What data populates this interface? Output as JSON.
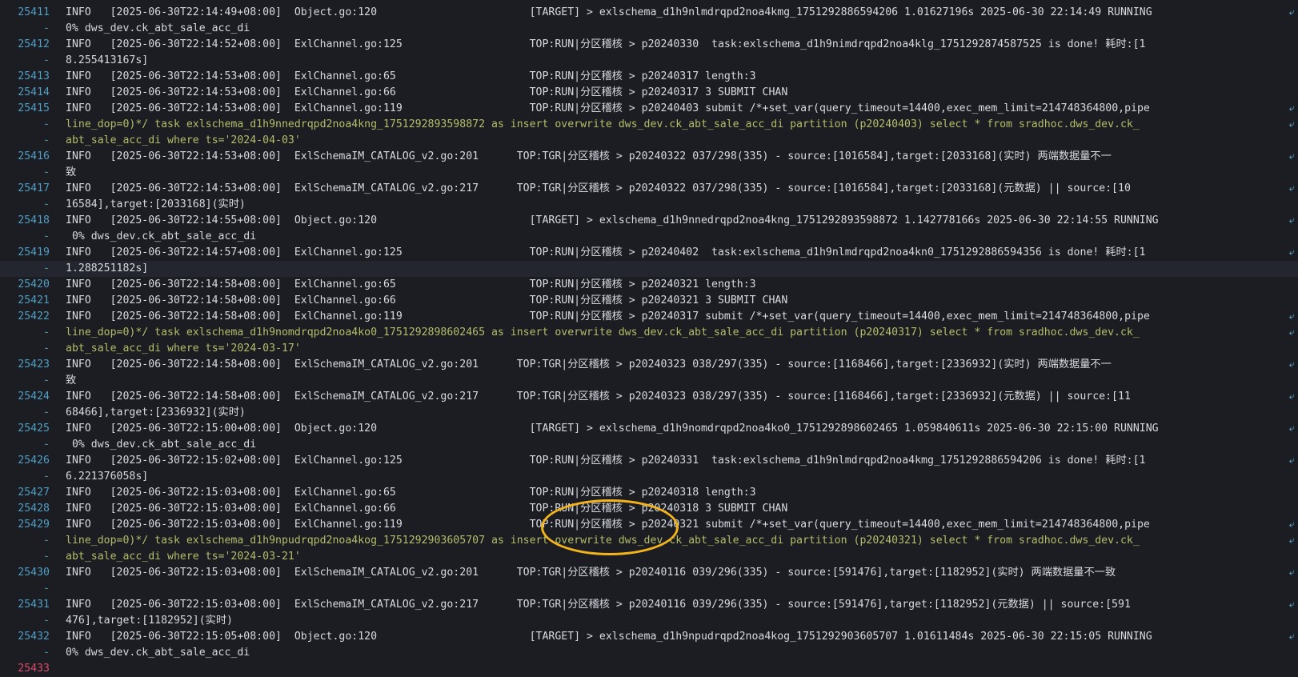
{
  "lines": [
    {
      "gutter": "25411",
      "text": "INFO   [2025-06-30T22:14:49+08:00]  Object.go:120                        [TARGET] > exlschema_d1h9nlmdrqpd2noa4kmg_1751292886594206 1.01627196s 2025-06-30 22:14:49 RUNNING",
      "wrap": true
    },
    {
      "gutter": "-",
      "text": "0% dws_dev.ck_abt_sale_acc_di"
    },
    {
      "gutter": "25412",
      "text": "INFO   [2025-06-30T22:14:52+08:00]  ExlChannel.go:125                    TOP:RUN|分区稽核 > p20240330  task:exlschema_d1h9nimdrqpd2noa4klg_1751292874587525 is done! 耗时:[1",
      "wrap": false
    },
    {
      "gutter": "-",
      "text": "8.255413167s]"
    },
    {
      "gutter": "25413",
      "text": "INFO   [2025-06-30T22:14:53+08:00]  ExlChannel.go:65                     TOP:RUN|分区稽核 > p20240317 length:3"
    },
    {
      "gutter": "25414",
      "text": "INFO   [2025-06-30T22:14:53+08:00]  ExlChannel.go:66                     TOP:RUN|分区稽核 > p20240317 3 SUBMIT CHAN"
    },
    {
      "gutter": "25415",
      "text": "INFO   [2025-06-30T22:14:53+08:00]  ExlChannel.go:119                    TOP:RUN|分区稽核 > p20240403 submit /*+set_var(query_timeout=14400,exec_mem_limit=214748364800,pipe",
      "wrap": true
    },
    {
      "gutter": "-",
      "text": "line_dop=0)*/ task exlschema_d1h9nnedrqpd2noa4kng_1751292893598872 as insert overwrite dws_dev.ck_abt_sale_acc_di partition (p20240403) select * from sradhoc.dws_dev.ck_",
      "wrap": true
    },
    {
      "gutter": "-",
      "text": "abt_sale_acc_di where ts='2024-04-03'"
    },
    {
      "gutter": "25416",
      "text": "INFO   [2025-06-30T22:14:53+08:00]  ExlSchemaIM_CATALOG_v2.go:201      TOP:TGR|分区稽核 > p20240322 037/298(335) - source:[1016584],target:[2033168](实时) 两端数据量不一",
      "wrap": true
    },
    {
      "gutter": "-",
      "text": "致"
    },
    {
      "gutter": "25417",
      "text": "INFO   [2025-06-30T22:14:53+08:00]  ExlSchemaIM_CATALOG_v2.go:217      TOP:TGR|分区稽核 > p20240322 037/298(335) - source:[1016584],target:[2033168](元数据) || source:[10",
      "wrap": true
    },
    {
      "gutter": "-",
      "text": "16584],target:[2033168](实时)"
    },
    {
      "gutter": "25418",
      "text": "INFO   [2025-06-30T22:14:55+08:00]  Object.go:120                        [TARGET] > exlschema_d1h9nnedrqpd2noa4kng_1751292893598872 1.142778166s 2025-06-30 22:14:55 RUNNING",
      "wrap": true
    },
    {
      "gutter": "-",
      "text": " 0% dws_dev.ck_abt_sale_acc_di"
    },
    {
      "gutter": "25419",
      "text": "INFO   [2025-06-30T22:14:57+08:00]  ExlChannel.go:125                    TOP:RUN|分区稽核 > p20240402  task:exlschema_d1h9nlmdrqpd2noa4kn0_1751292886594356 is done! 耗时:[1",
      "wrap": true
    },
    {
      "gutter": "-",
      "text": "1.288251182s]",
      "hl": true
    },
    {
      "gutter": "25420",
      "text": "INFO   [2025-06-30T22:14:58+08:00]  ExlChannel.go:65                     TOP:RUN|分区稽核 > p20240321 length:3"
    },
    {
      "gutter": "25421",
      "text": "INFO   [2025-06-30T22:14:58+08:00]  ExlChannel.go:66                     TOP:RUN|分区稽核 > p20240321 3 SUBMIT CHAN"
    },
    {
      "gutter": "25422",
      "text": "INFO   [2025-06-30T22:14:58+08:00]  ExlChannel.go:119                    TOP:RUN|分区稽核 > p20240317 submit /*+set_var(query_timeout=14400,exec_mem_limit=214748364800,pipe",
      "wrap": true
    },
    {
      "gutter": "-",
      "text": "line_dop=0)*/ task exlschema_d1h9nomdrqpd2noa4ko0_1751292898602465 as insert overwrite dws_dev.ck_abt_sale_acc_di partition (p20240317) select * from sradhoc.dws_dev.ck_",
      "wrap": true
    },
    {
      "gutter": "-",
      "text": "abt_sale_acc_di where ts='2024-03-17'"
    },
    {
      "gutter": "25423",
      "text": "INFO   [2025-06-30T22:14:58+08:00]  ExlSchemaIM_CATALOG_v2.go:201      TOP:TGR|分区稽核 > p20240323 038/297(335) - source:[1168466],target:[2336932](实时) 两端数据量不一",
      "wrap": true
    },
    {
      "gutter": "-",
      "text": "致"
    },
    {
      "gutter": "25424",
      "text": "INFO   [2025-06-30T22:14:58+08:00]  ExlSchemaIM_CATALOG_v2.go:217      TOP:TGR|分区稽核 > p20240323 038/297(335) - source:[1168466],target:[2336932](元数据) || source:[11",
      "wrap": true
    },
    {
      "gutter": "-",
      "text": "68466],target:[2336932](实时)"
    },
    {
      "gutter": "25425",
      "text": "INFO   [2025-06-30T22:15:00+08:00]  Object.go:120                        [TARGET] > exlschema_d1h9nomdrqpd2noa4ko0_1751292898602465 1.059840611s 2025-06-30 22:15:00 RUNNING",
      "wrap": true
    },
    {
      "gutter": "-",
      "text": " 0% dws_dev.ck_abt_sale_acc_di"
    },
    {
      "gutter": "25426",
      "text": "INFO   [2025-06-30T22:15:02+08:00]  ExlChannel.go:125                    TOP:RUN|分区稽核 > p20240331  task:exlschema_d1h9nlmdrqpd2noa4kmg_1751292886594206 is done! 耗时:[1",
      "wrap": true
    },
    {
      "gutter": "-",
      "text": "6.221376058s]"
    },
    {
      "gutter": "25427",
      "text": "INFO   [2025-06-30T22:15:03+08:00]  ExlChannel.go:65                     TOP:RUN|分区稽核 > p20240318 length:3"
    },
    {
      "gutter": "25428",
      "text": "INFO   [2025-06-30T22:15:03+08:00]  ExlChannel.go:66                     TOP:RUN|分区稽核 > p20240318 3 SUBMIT CHAN"
    },
    {
      "gutter": "25429",
      "text": "INFO   [2025-06-30T22:15:03+08:00]  ExlChannel.go:119                    TOP:RUN|分区稽核 > p20240321 submit /*+set_var(query_timeout=14400,exec_mem_limit=214748364800,pipe",
      "wrap": true
    },
    {
      "gutter": "-",
      "text": "line_dop=0)*/ task exlschema_d1h9npudrqpd2noa4kog_1751292903605707 as insert overwrite dws_dev.ck_abt_sale_acc_di partition (p20240321) select * from sradhoc.dws_dev.ck_",
      "wrap": true
    },
    {
      "gutter": "-",
      "text": "abt_sale_acc_di where ts='2024-03-21'"
    },
    {
      "gutter": "25430",
      "text": "INFO   [2025-06-30T22:15:03+08:00]  ExlSchemaIM_CATALOG_v2.go:201      TOP:TGR|分区稽核 > p20240116 039/296(335) - source:[591476],target:[1182952](实时) 两端数据量不一致",
      "wrap": true
    },
    {
      "gutter": "-",
      "text": ""
    },
    {
      "gutter": "25431",
      "text": "INFO   [2025-06-30T22:15:03+08:00]  ExlSchemaIM_CATALOG_v2.go:217      TOP:TGR|分区稽核 > p20240116 039/296(335) - source:[591476],target:[1182952](元数据) || source:[591",
      "wrap": true
    },
    {
      "gutter": "-",
      "text": "476],target:[1182952](实时)"
    },
    {
      "gutter": "25432",
      "text": "INFO   [2025-06-30T22:15:05+08:00]  Object.go:120                        [TARGET] > exlschema_d1h9npudrqpd2noa4kog_1751292903605707 1.01611484s 2025-06-30 22:15:05 RUNNING",
      "wrap": true
    },
    {
      "gutter": "-",
      "text": "0% dws_dev.ck_abt_sale_acc_di"
    },
    {
      "gutter": "25433",
      "text": "",
      "cur": true
    }
  ],
  "wrap_glyph": "⤶",
  "annotation_color": "#f2b31b"
}
